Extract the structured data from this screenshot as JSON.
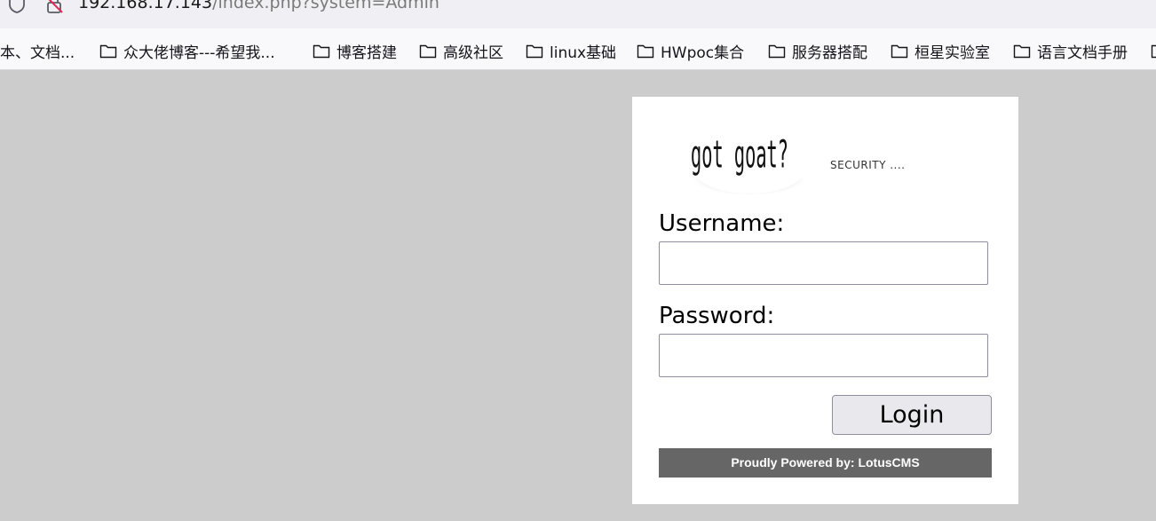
{
  "browser": {
    "url_host": "192.168.17.143",
    "url_path": "/index.php?system=Admin",
    "bookmarks": [
      {
        "label": "本、文档...",
        "has_folder_icon": false
      },
      {
        "label": "众大佬博客---希望我...",
        "has_folder_icon": true
      },
      {
        "label": "博客搭建",
        "has_folder_icon": true
      },
      {
        "label": "高级社区",
        "has_folder_icon": true
      },
      {
        "label": "linux基础",
        "has_folder_icon": true
      },
      {
        "label": "HWpoc集合",
        "has_folder_icon": true
      },
      {
        "label": "服务器搭配",
        "has_folder_icon": true
      },
      {
        "label": "桓星实验室",
        "has_folder_icon": true
      },
      {
        "label": "语言文档手册",
        "has_folder_icon": true
      }
    ]
  },
  "login": {
    "logo_text": "got goat?",
    "tagline": "SECURITY ....",
    "username_label": "Username:",
    "username_value": "",
    "password_label": "Password:",
    "password_value": "",
    "login_label": "Login",
    "footer": "Proudly Powered by: LotusCMS"
  },
  "colors": {
    "page_background": "#cccccc",
    "panel_background": "#ffffff",
    "footer_background": "#666666",
    "button_background": "#e9e9ed"
  }
}
